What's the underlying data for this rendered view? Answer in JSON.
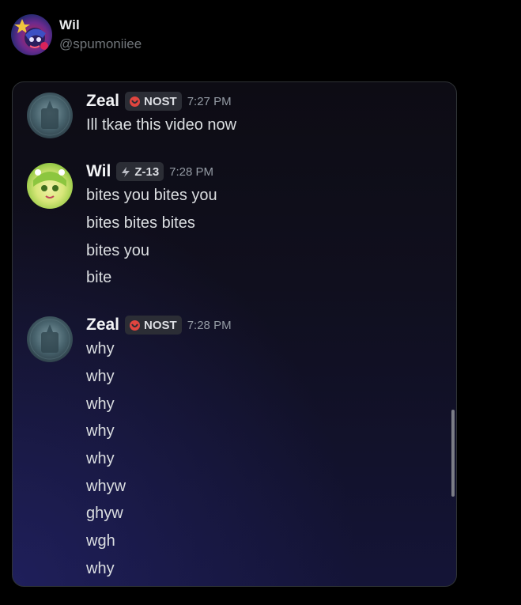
{
  "post": {
    "author_name": "Wil",
    "author_handle": "@spumoniiee"
  },
  "chat": {
    "messages": [
      {
        "user": "Zeal",
        "tag": "NOST",
        "tag_icon": "red-circle-icon",
        "time": "7:27 PM",
        "lines": [
          "Ill tkae this video now"
        ]
      },
      {
        "user": "Wil",
        "tag": "Z-13",
        "tag_icon": "lightning-icon",
        "time": "7:28 PM",
        "lines": [
          "bites you bites you",
          "bites bites bites",
          "bites you",
          "bite"
        ]
      },
      {
        "user": "Zeal",
        "tag": "NOST",
        "tag_icon": "red-circle-icon",
        "time": "7:28 PM",
        "lines": [
          "why",
          "why",
          "why",
          "why",
          "why",
          "whyw",
          "ghyw",
          "wgh",
          "why"
        ]
      }
    ]
  },
  "colors": {
    "background": "#000000",
    "card_border": "#2f3336",
    "username": "#f2f3f5",
    "message_text": "#dbdee1",
    "timestamp": "#949ba4",
    "tag_background": "#2b2d35",
    "nost_icon": "#e0453f",
    "z13_icon": "#b9bbc3"
  }
}
